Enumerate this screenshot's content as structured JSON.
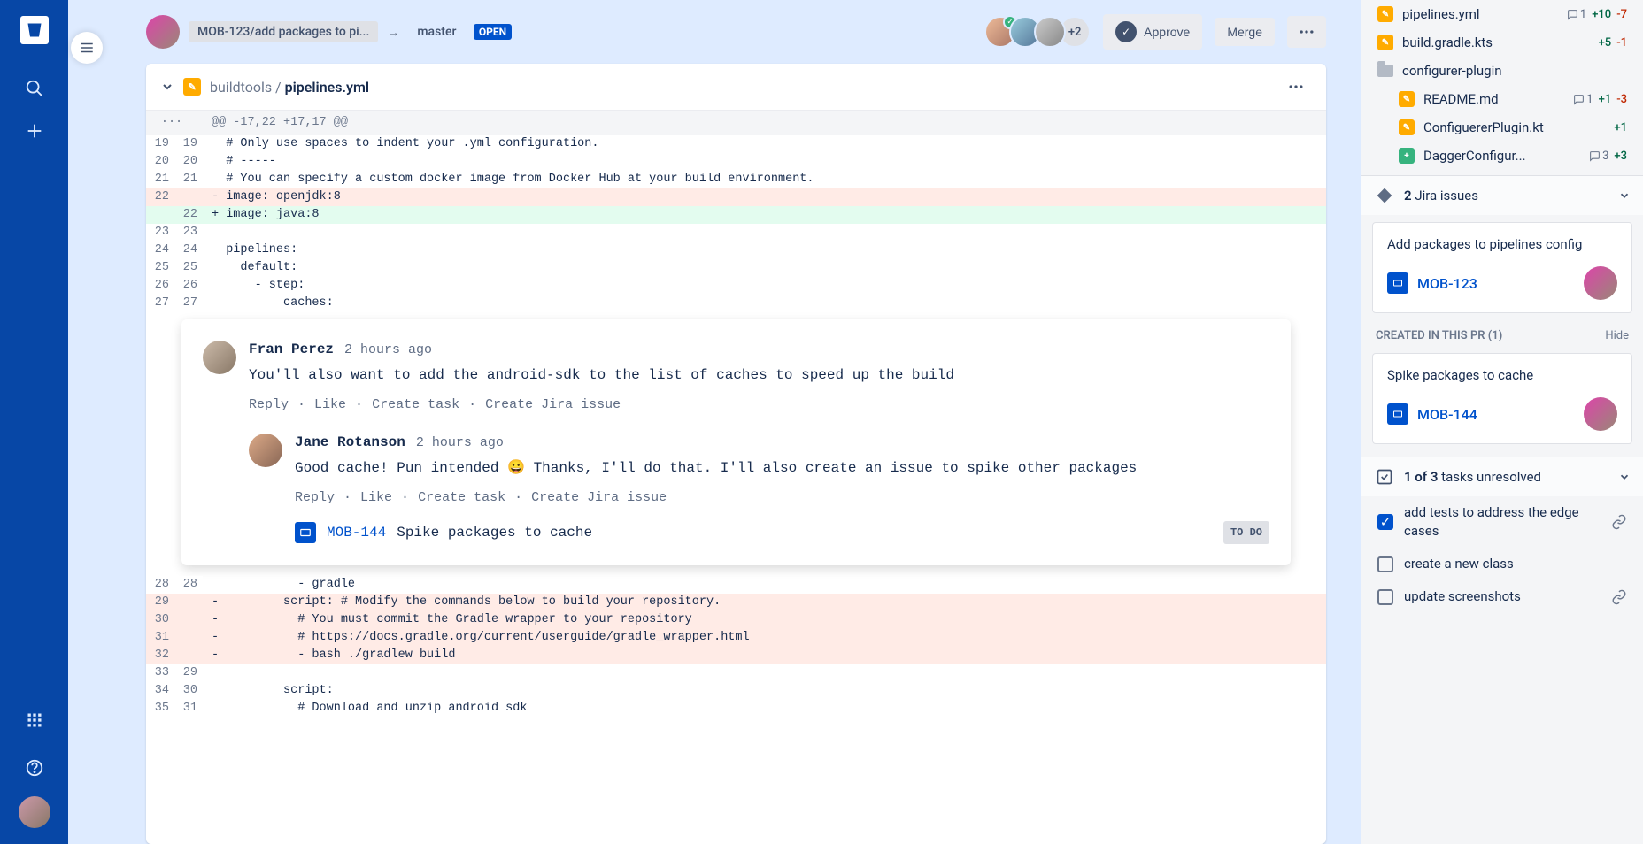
{
  "header": {
    "source_branch": "MOB-123/add packages to pi...",
    "target_branch": "master",
    "status": "OPEN",
    "reviewers_extra": "+2",
    "approve_label": "Approve",
    "merge_label": "Merge"
  },
  "diff": {
    "path_prefix": "buildtools / ",
    "filename": "pipelines.yml",
    "hunk": "@@ -17,22 +17,17 @@",
    "lines": [
      {
        "old": "19",
        "new": "19",
        "type": "ctx",
        "text": "# Only use spaces to indent your .yml configuration."
      },
      {
        "old": "20",
        "new": "20",
        "type": "ctx",
        "text": "# -----"
      },
      {
        "old": "21",
        "new": "21",
        "type": "ctx",
        "text": "# You can specify a custom docker image from Docker Hub at your build environment."
      },
      {
        "old": "22",
        "new": "",
        "type": "del",
        "text": "image: openjdk:8"
      },
      {
        "old": "",
        "new": "22",
        "type": "add",
        "text": "image: java:8"
      },
      {
        "old": "23",
        "new": "23",
        "type": "ctx",
        "text": ""
      },
      {
        "old": "24",
        "new": "24",
        "type": "ctx",
        "text": "pipelines:"
      },
      {
        "old": "25",
        "new": "25",
        "type": "ctx",
        "text": "  default:"
      },
      {
        "old": "26",
        "new": "26",
        "type": "ctx",
        "text": "    - step:"
      },
      {
        "old": "27",
        "new": "27",
        "type": "ctx",
        "text": "        caches:"
      }
    ],
    "lines_after": [
      {
        "old": "28",
        "new": "28",
        "type": "ctx",
        "text": "          - gradle"
      },
      {
        "old": "29",
        "new": "",
        "type": "del",
        "text": "        script: # Modify the commands below to build your repository."
      },
      {
        "old": "30",
        "new": "",
        "type": "del",
        "text": "          # You must commit the Gradle wrapper to your repository"
      },
      {
        "old": "31",
        "new": "",
        "type": "del",
        "text": "          # https://docs.gradle.org/current/userguide/gradle_wrapper.html"
      },
      {
        "old": "32",
        "new": "",
        "type": "del",
        "text": "          - bash ./gradlew build"
      },
      {
        "old": "33",
        "new": "29",
        "type": "ctx",
        "text": ""
      },
      {
        "old": "34",
        "new": "30",
        "type": "ctx",
        "text": "        script:"
      },
      {
        "old": "35",
        "new": "31",
        "type": "ctx",
        "text": "          # Download and unzip android sdk"
      }
    ]
  },
  "comments": [
    {
      "author": "Fran Perez",
      "time": "2 hours ago",
      "text": "You'll also want to add the android-sdk to the list of caches to speed up the build",
      "actions": {
        "reply": "Reply",
        "like": "Like",
        "task": "Create task",
        "jira": "Create Jira issue"
      }
    },
    {
      "author": "Jane Rotanson",
      "time": "2 hours ago",
      "text": "Good cache! Pun intended 😀 Thanks, I'll do that. I'll also create an issue to spike other packages",
      "actions": {
        "reply": "Reply",
        "like": "Like",
        "task": "Create task",
        "jira": "Create Jira issue"
      },
      "linked": {
        "key": "MOB-144",
        "title": "Spike packages to cache",
        "status": "TO DO"
      }
    }
  ],
  "sidebar": {
    "files": [
      {
        "icon": "mod",
        "name": "pipelines.yml",
        "comments": "1",
        "plus": "+10",
        "minus": "-7",
        "nested": false
      },
      {
        "icon": "mod",
        "name": "build.gradle.kts",
        "plus": "+5",
        "minus": "-1",
        "nested": false
      },
      {
        "icon": "folder",
        "name": "configurer-plugin",
        "nested": false
      },
      {
        "icon": "mod",
        "name": "README.md",
        "comments": "1",
        "plus": "+1",
        "minus": "-3",
        "nested": true
      },
      {
        "icon": "mod",
        "name": "ConfiguererPlugin.kt",
        "plus": "+1",
        "nested": true
      },
      {
        "icon": "add",
        "name": "DaggerConfigur...",
        "comments": "3",
        "plus": "+3",
        "nested": true
      }
    ],
    "jira_panel": {
      "count": "2",
      "title": "Jira issues",
      "issues": [
        {
          "title": "Add packages to pipelines config",
          "key": "MOB-123"
        }
      ],
      "created_header": "CREATED IN THIS PR (1)",
      "hide_label": "Hide",
      "created": [
        {
          "title": "Spike packages to cache",
          "key": "MOB-144"
        }
      ]
    },
    "tasks_panel": {
      "header_count": "1 of 3",
      "header_label": "tasks unresolved",
      "tasks": [
        {
          "checked": true,
          "text": "add tests to address the edge cases",
          "link": true
        },
        {
          "checked": false,
          "text": "create a new class"
        },
        {
          "checked": false,
          "text": "update screenshots",
          "link": true
        }
      ]
    }
  }
}
